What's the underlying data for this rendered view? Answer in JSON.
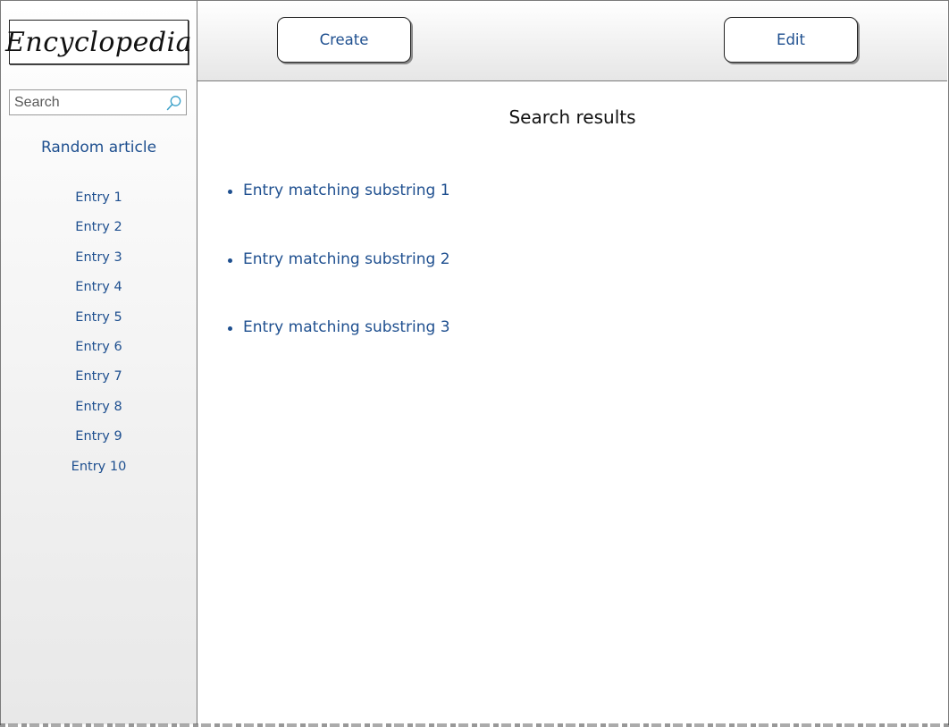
{
  "logo": {
    "text": "Encyclopedia"
  },
  "search": {
    "placeholder": "Search",
    "value": ""
  },
  "sidebar": {
    "random_label": "Random article",
    "entries": [
      "Entry 1",
      "Entry 2",
      "Entry 3",
      "Entry 4",
      "Entry 5",
      "Entry 6",
      "Entry 7",
      "Entry 8",
      "Entry 9",
      "Entry 10"
    ]
  },
  "toolbar": {
    "create_label": "Create",
    "edit_label": "Edit"
  },
  "main": {
    "title": "Search results",
    "results": [
      "Entry matching substring 1",
      "Entry matching substring 2",
      "Entry matching substring 3"
    ]
  },
  "colors": {
    "link": "#1e4f8f",
    "border": "#7a7a7a",
    "search_icon": "#3aa0c8"
  },
  "icons": {
    "search": "search-icon"
  }
}
